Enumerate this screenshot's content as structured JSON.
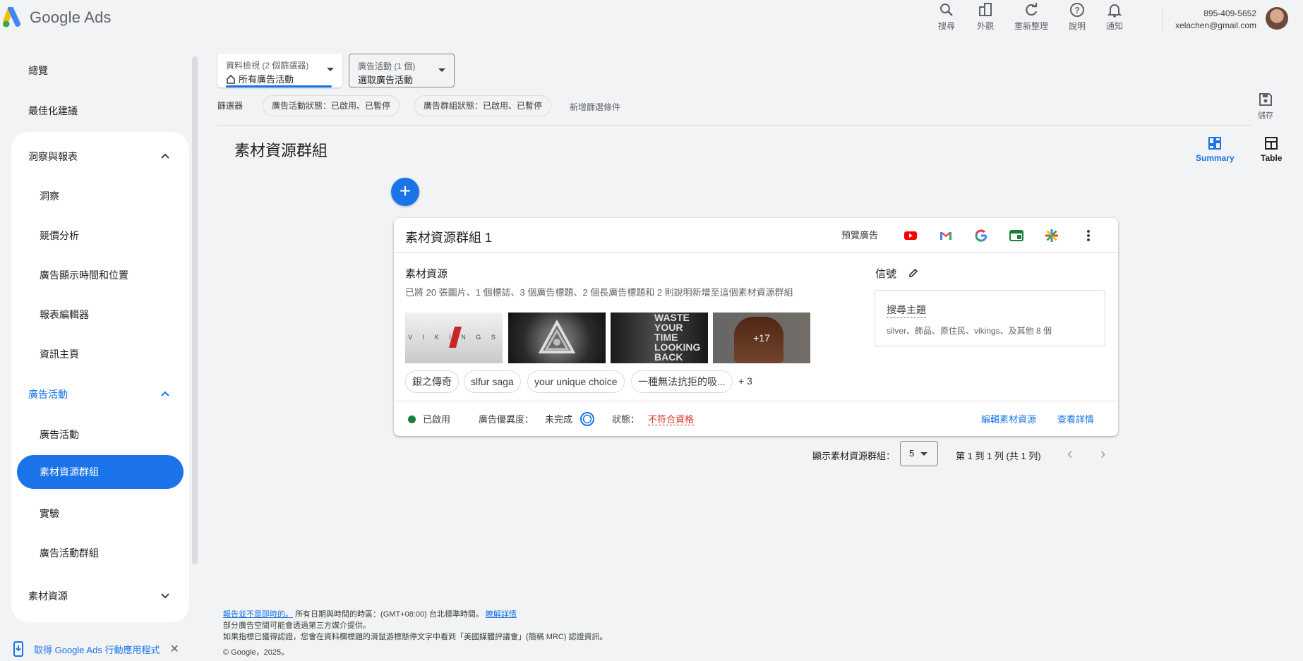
{
  "app": {
    "name": "Google Ads"
  },
  "toolbar": {
    "search": "搜尋",
    "appearance": "外觀",
    "refresh": "重新整理",
    "help": "說明",
    "notifications": "通知"
  },
  "account": {
    "id": "895-409-5652",
    "email": "xelachen@gmail.com"
  },
  "sidebar": {
    "overview": "總覽",
    "recommendations": "最佳化建議",
    "insights_section": {
      "title": "洞察與報表",
      "items": [
        "洞察",
        "競價分析",
        "廣告顯示時間和位置",
        "報表編輯器",
        "資訊主頁"
      ]
    },
    "campaigns_section": {
      "title": "廣告活動",
      "items": [
        "廣告活動",
        "素材資源群組",
        "實驗",
        "廣告活動群組"
      ]
    },
    "assets": "素材資源",
    "app_promo": "取得 Google Ads 行動應用程式"
  },
  "filters": {
    "data_view": {
      "label": "資料檢視 (2 個篩選器)",
      "value": "所有廣告活動"
    },
    "campaign": {
      "label": "廣告活動 (1 個)",
      "value": "選取廣告活動"
    },
    "filters_label": "篩選器",
    "chips": [
      "廣告活動狀態：已啟用、已暫停",
      "廣告群組狀態：已啟用、已暫停"
    ],
    "add_filter": "新增篩選條件",
    "save": "儲存"
  },
  "page": {
    "title": "素材資源群組",
    "views": {
      "summary": "Summary",
      "table": "Table"
    }
  },
  "card": {
    "title": "素材資源群組 1",
    "preview": "預覽廣告",
    "assets_heading": "素材資源",
    "assets_desc": "已將 20 張圖片、1 個標誌、3 個廣告標題、2 個長廣告標題和 2 則說明新增至這個素材資源群組",
    "images": [
      "vikings-logo",
      "celtic-knot",
      "dont-waste-your-time",
      "native-chief"
    ],
    "more_images": "+17",
    "headlines": [
      "銀之傳奇",
      "slfur saga",
      "your unique choice",
      "一種無法抗拒的吸..."
    ],
    "more_headlines": "+ 3",
    "signals_heading": "信號",
    "signal_title": "搜尋主題",
    "signal_desc": "silver、飾品、原住民、vikings、及其他 8 個",
    "status_enabled": "已啟用",
    "ad_strength_label": "廣告優異度：",
    "ad_strength_value": "未完成",
    "status_label": "狀態：",
    "status_value": "不符合資格",
    "edit_link": "編輯素材資源",
    "details_link": "查看詳情"
  },
  "pager": {
    "rows_label": "顯示素材資源群組：",
    "rows_value": "5",
    "range": "第 1 到 1 列 (共 1 列)"
  },
  "footer": {
    "line1_link": "報告並不是即時的。",
    "line1_text": "所有日期與時間的時區：(GMT+08:00) 台北標準時間。",
    "line1_more": "瞭解詳情",
    "line2": "部分廣告空間可能會透過第三方媒介提供。",
    "line3": "如果指標已獲得認證，您會在資料欄標題的滑鼠游標懸停文字中看到「美國媒體評議會」(簡稱 MRC) 認證資訊。",
    "copyright": "© Google，2025。"
  },
  "colors": {
    "accent": "#1a73e8",
    "enabled": "#188038",
    "error": "#d93025"
  }
}
